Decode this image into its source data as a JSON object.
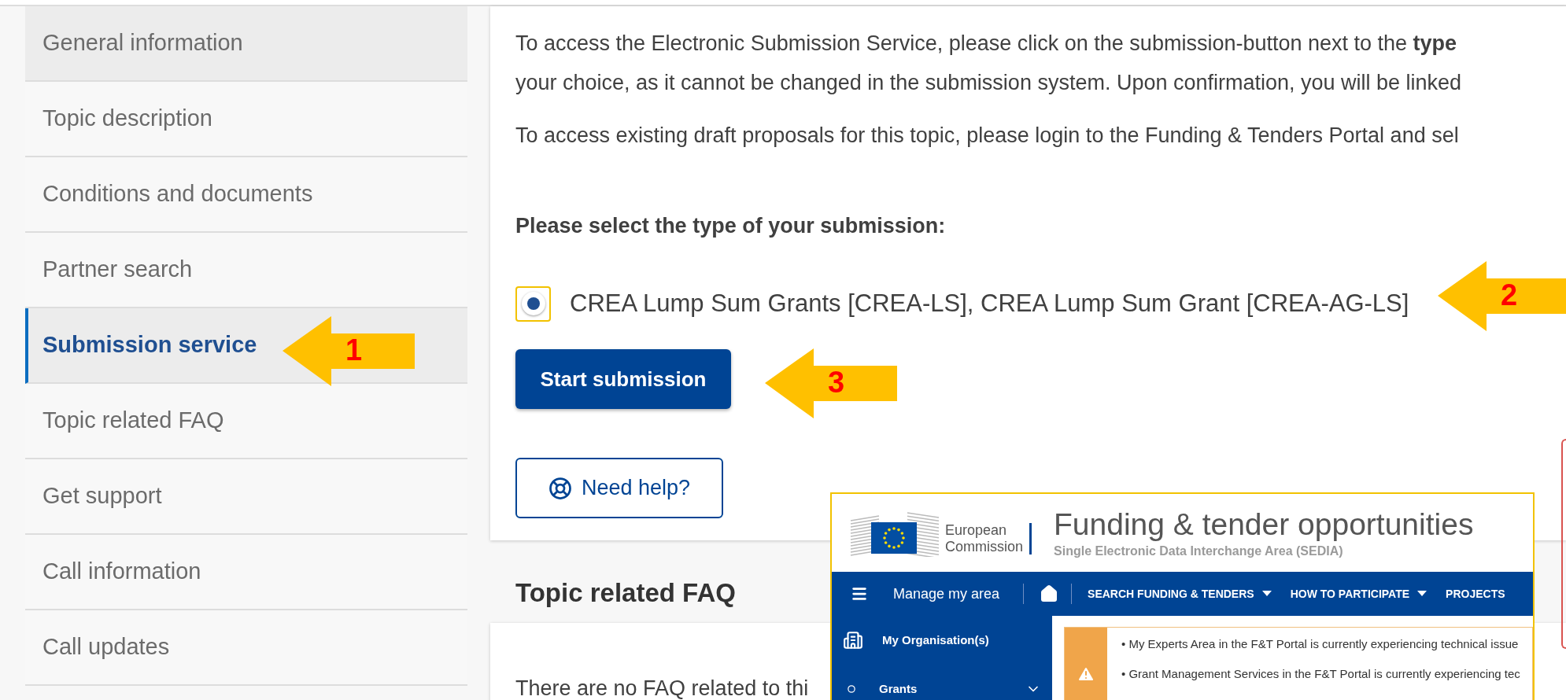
{
  "sidebar": {
    "items": [
      {
        "label": "General information",
        "selected": false,
        "hovered": true
      },
      {
        "label": "Topic description",
        "selected": false,
        "hovered": false
      },
      {
        "label": "Conditions and documents",
        "selected": false,
        "hovered": false
      },
      {
        "label": "Partner search",
        "selected": false,
        "hovered": false
      },
      {
        "label": "Submission service",
        "selected": true,
        "hovered": false
      },
      {
        "label": "Topic related FAQ",
        "selected": false,
        "hovered": false
      },
      {
        "label": "Get support",
        "selected": false,
        "hovered": false
      },
      {
        "label": "Call information",
        "selected": false,
        "hovered": false
      },
      {
        "label": "Call updates",
        "selected": false,
        "hovered": false
      }
    ]
  },
  "submission": {
    "intro_lines": [
      "To access the Electronic Submission Service, please click on the submission-button next to the **type**",
      "your choice, as it cannot be changed in the submission system. Upon confirmation, you will be linked"
    ],
    "draft_note": "To access existing draft proposals for this topic, please login to the Funding & Tenders Portal and sel",
    "prompt": "Please select the type of your submission:",
    "options": [
      {
        "label": "CREA Lump Sum Grants [CREA-LS], CREA Lump Sum Grant [CREA-AG-LS]",
        "selected": true,
        "focused": true
      }
    ],
    "start_button": "Start submission",
    "help_button": "Need help?"
  },
  "faq": {
    "heading": "Topic related FAQ",
    "text": "There are no FAQ related to thi"
  },
  "annotations": [
    {
      "number": "1"
    },
    {
      "number": "2"
    },
    {
      "number": "3"
    }
  ],
  "inset": {
    "logo_lines": [
      "European",
      "Commission"
    ],
    "title": "Funding & tender opportunities",
    "subtitle": "Single Electronic Data Interchange Area (SEDIA)",
    "menu_label": "Manage my area",
    "nav_items": [
      {
        "label": "SEARCH FUNDING & TENDERS",
        "dropdown": true
      },
      {
        "label": "HOW TO PARTICIPATE",
        "dropdown": true
      },
      {
        "label": "PROJECTS",
        "dropdown": false
      }
    ],
    "side_items": [
      {
        "label": "My Organisation(s)",
        "kind": "building"
      },
      {
        "label": "Grants",
        "kind": "expandable"
      }
    ],
    "alerts": [
      "• My Experts Area in the F&T Portal is currently experiencing technical issue",
      "• Grant Management Services in the F&T Portal is currently experiencing tec"
    ]
  }
}
